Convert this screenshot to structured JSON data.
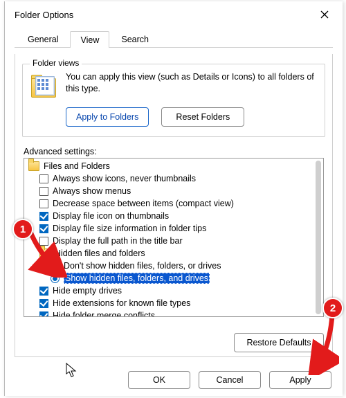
{
  "window": {
    "title": "Folder Options"
  },
  "tabs": {
    "general": "General",
    "view": "View",
    "search": "Search"
  },
  "folder_views": {
    "legend": "Folder views",
    "desc": "You can apply this view (such as Details or Icons) to all folders of this type.",
    "apply_btn": "Apply to Folders",
    "reset_btn": "Reset Folders"
  },
  "advanced": {
    "label": "Advanced settings:",
    "root": "Files and Folders",
    "items": {
      "always_icons": "Always show icons, never thumbnails",
      "always_menus": "Always show menus",
      "compact": "Decrease space between items (compact view)",
      "thumb_icon": "Display file icon on thumbnails",
      "folder_tips": "Display file size information in folder tips",
      "full_path": "Display the full path in the title bar",
      "hidden_group": "Hidden files and folders",
      "dont_show_hidden": "Don't show hidden files, folders, or drives",
      "show_hidden": "Show hidden files, folders, and drives",
      "hide_empty": "Hide empty drives",
      "hide_ext": "Hide extensions for known file types",
      "hide_merge": "Hide folder merge conflicts"
    }
  },
  "buttons": {
    "restore_defaults": "Restore Defaults",
    "ok": "OK",
    "cancel": "Cancel",
    "apply": "Apply"
  },
  "annotations": {
    "b1": "1",
    "b2": "2"
  }
}
